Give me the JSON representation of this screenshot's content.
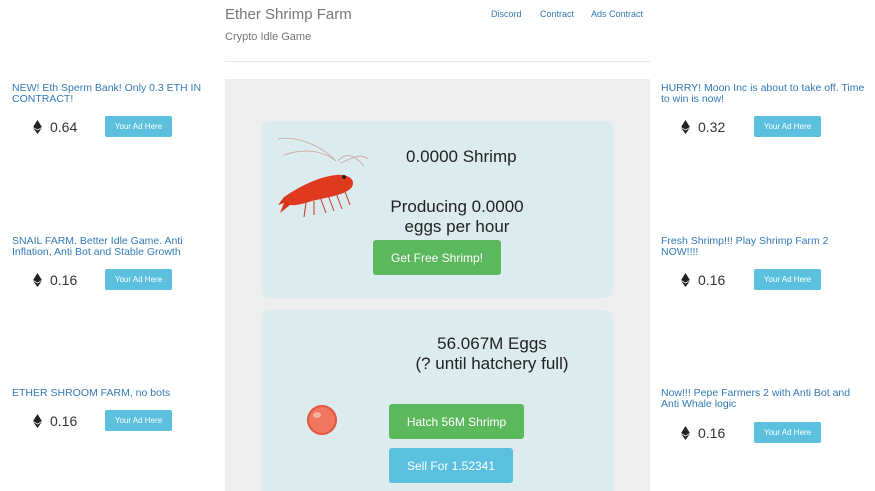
{
  "header": {
    "title": "Ether Shrimp Farm",
    "subtitle": "Crypto Idle Game",
    "nav": [
      "Discord",
      "Contract",
      "Ads Contract"
    ]
  },
  "ads_left": [
    {
      "text": "NEW! Eth Sperm Bank! Only 0.3 ETH IN CONTRACT!",
      "price": "0.64",
      "button": "Your Ad Here"
    },
    {
      "text": "SNAIL FARM. Better Idle Game. Anti Inflation, Anti Bot and Stable Growth",
      "price": "0.16",
      "button": "Your Ad Here"
    },
    {
      "text": "ETHER SHROOM FARM, no bots",
      "price": "0.16",
      "button": "Your Ad Here"
    }
  ],
  "ads_right": [
    {
      "text": "HURRY! Moon Inc is about to take off. Time to win is now!",
      "price": "0.32",
      "button": "Your Ad Here"
    },
    {
      "text": "Fresh Shrimp!!! Play Shrimp Farm 2 NOW!!!!",
      "price": "0.16",
      "button": "Your Ad Here"
    },
    {
      "text": "Now!!! Pepe Farmers 2 with Anti Bot and Anti Whale logic",
      "price": "0.16",
      "button": "Your Ad Here"
    }
  ],
  "farm": {
    "shrimp_count": "0.0000 Shrimp",
    "producing": "Producing 0.0000 eggs per hour",
    "free_button": "Get Free Shrimp!"
  },
  "hatchery": {
    "eggs": "56.067M Eggs",
    "full_time": "(? until hatchery full)",
    "hatch_button": "Hatch 56M Shrimp",
    "sell_button": "Sell For 1.52341"
  },
  "colors": {
    "link": "#337ab7",
    "info": "#5bc0de",
    "success": "#5cb85c",
    "card": "#dcebed",
    "panel": "#eeeeee"
  }
}
